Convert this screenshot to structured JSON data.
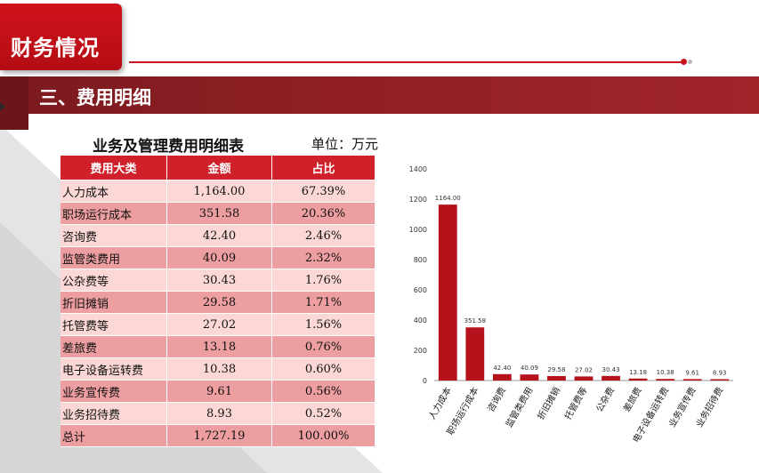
{
  "brand": {
    "title": "财务情况"
  },
  "section": {
    "title": "三、费用明细"
  },
  "table": {
    "title": "业务及管理费用明细表",
    "unit": "单位：万元",
    "headers": [
      "费用大类",
      "金额",
      "占比"
    ],
    "rows": [
      {
        "category": "人力成本",
        "amount": "1,164.00",
        "ratio": "67.39%"
      },
      {
        "category": "职场运行成本",
        "amount": "351.58",
        "ratio": "20.36%"
      },
      {
        "category": "咨询费",
        "amount": "42.40",
        "ratio": "2.46%"
      },
      {
        "category": "监管类费用",
        "amount": "40.09",
        "ratio": "2.32%"
      },
      {
        "category": "公杂费等",
        "amount": "30.43",
        "ratio": "1.76%"
      },
      {
        "category": "折旧摊销",
        "amount": "29.58",
        "ratio": "1.71%"
      },
      {
        "category": "托管费等",
        "amount": "27.02",
        "ratio": "1.56%"
      },
      {
        "category": "差旅费",
        "amount": "13.18",
        "ratio": "0.76%"
      },
      {
        "category": "电子设备运转费",
        "amount": "10.38",
        "ratio": "0.60%"
      },
      {
        "category": "业务宣传费",
        "amount": "9.61",
        "ratio": "0.56%"
      },
      {
        "category": "业务招待费",
        "amount": "8.93",
        "ratio": "0.52%"
      },
      {
        "category": "总计",
        "amount": "1,727.19",
        "ratio": "100.00%"
      }
    ]
  },
  "chart_data": {
    "type": "bar",
    "categories": [
      "人力成本",
      "职场运行成本",
      "咨询费",
      "监管类费用",
      "折旧摊销",
      "托管费等",
      "公杂费",
      "差旅费",
      "电子设备运转费",
      "业务宣传费",
      "业务招待费"
    ],
    "values": [
      1164.0,
      351.58,
      42.4,
      40.09,
      29.58,
      27.02,
      30.43,
      13.18,
      10.38,
      9.61,
      8.93
    ],
    "data_labels": [
      "1164.00",
      "351.58",
      "42.40",
      "40.09",
      "29.58",
      "27.02",
      "30.43",
      "13.18",
      "10.38",
      "9.61",
      "8.93"
    ],
    "ylim": [
      0,
      1400
    ],
    "yticks": [
      0,
      200,
      400,
      600,
      800,
      1000,
      1200,
      1400
    ],
    "bar_color": "#b5121b",
    "grid": false,
    "legend": "none"
  }
}
